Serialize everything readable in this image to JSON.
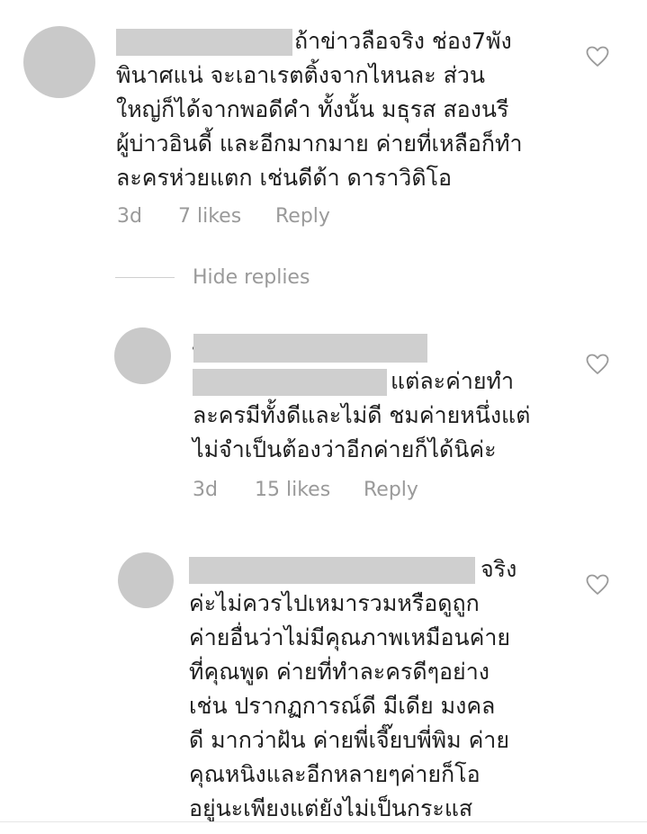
{
  "comments": [
    {
      "username": "",
      "first_line": "ถ้าข่าวลือจริง ช่อง7พัง",
      "lines": [
        "พินาศแน่ จะเอาเรตติ้งจากไหนละ ส่วน",
        "ใหญ่ก็ได้จากพอดีคำ ทั้งนั้น มธุรส สองนรี",
        "ผู้บ่าวอินดี้ และอีกมากมาย ค่ายที่เหลือก็ทำ",
        "ละครห่วยแตก เช่นดีด้า ดาราวิดิโอ"
      ],
      "time": "3d",
      "likes": "7 likes",
      "reply_label": "Reply",
      "like_icon": "heart-outline-icon"
    }
  ],
  "hide_replies_label": "Hide replies",
  "replies": [
    {
      "username": "",
      "first_line": "แต่ละค่ายทำ",
      "lines": [
        "ละครมีทั้งดีและไม่ดี ชมค่ายหนึ่งแต่",
        "ไม่จำเป็นต้องว่าอีกค่ายก็ได้นิค่ะ"
      ],
      "time": "3d",
      "likes": "15 likes",
      "reply_label": "Reply",
      "like_icon": "heart-outline-icon"
    },
    {
      "username": "",
      "first_line": "จริง",
      "lines": [
        "ค่ะไม่ควรไปเหมารวมหรือดูถูก",
        "ค่ายอื่นว่าไม่มีคุณภาพเหมือนค่าย",
        "ที่คุณพูด ค่ายที่ทำละครดีๆอย่าง",
        "เช่น ปรากฏการณ์ดี มีเดีย มงคล",
        "ดี มากว่าฝัน ค่ายพี่เจี๊ยบพี่พิม ค่าย",
        "คุณหนิงและอีกหลายๆค่ายก็โอ",
        "อยู่นะเพียงแต่ยังไม่เป็นกระแส"
      ],
      "like_icon": "heart-outline-icon"
    }
  ],
  "colors": {
    "text": "#1f1f1f",
    "meta": "#9a9a9a",
    "avatar": "#c9c9c9",
    "redaction": "#cfcfcf"
  }
}
